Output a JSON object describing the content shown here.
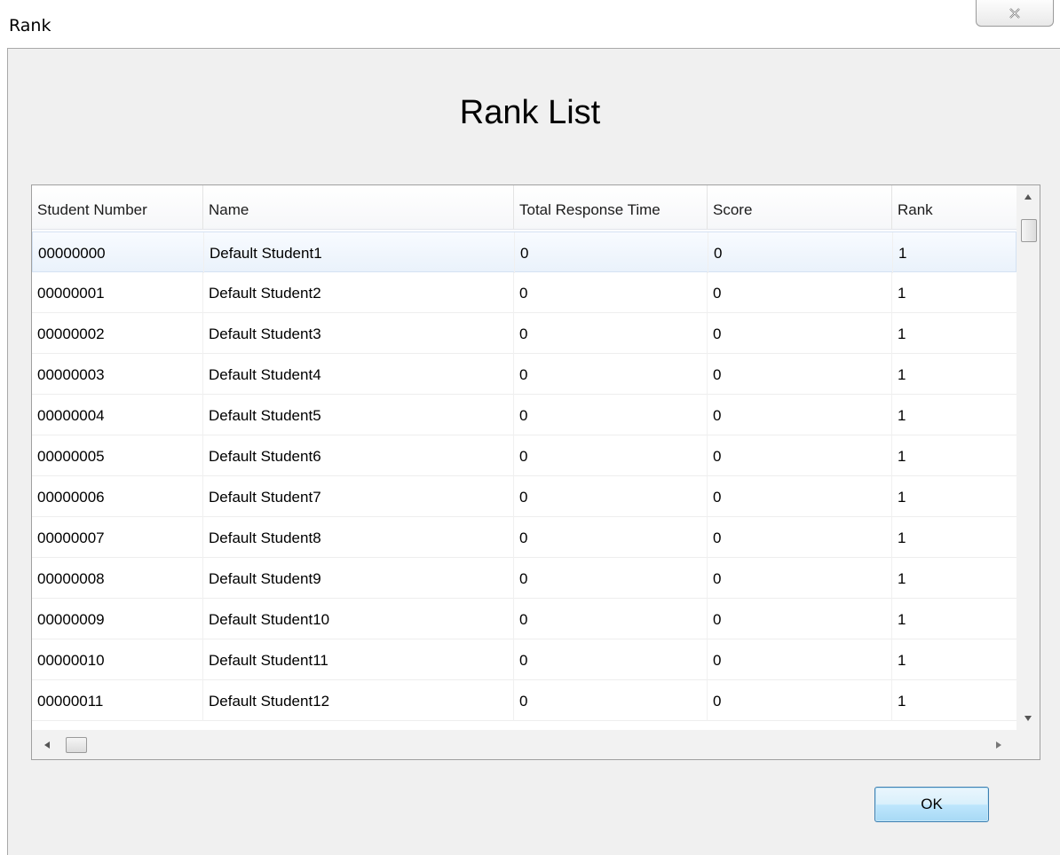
{
  "window": {
    "title": "Rank",
    "close_icon": "close-icon"
  },
  "page_title": "Rank List",
  "table": {
    "columns": [
      "Student Number",
      "Name",
      "Total Response Time",
      "Score",
      "Rank"
    ],
    "rows": [
      [
        "00000000",
        "Default Student1",
        "0",
        "0",
        "1"
      ],
      [
        "00000001",
        "Default Student2",
        "0",
        "0",
        "1"
      ],
      [
        "00000002",
        "Default Student3",
        "0",
        "0",
        "1"
      ],
      [
        "00000003",
        "Default Student4",
        "0",
        "0",
        "1"
      ],
      [
        "00000004",
        "Default Student5",
        "0",
        "0",
        "1"
      ],
      [
        "00000005",
        "Default Student6",
        "0",
        "0",
        "1"
      ],
      [
        "00000006",
        "Default Student7",
        "0",
        "0",
        "1"
      ],
      [
        "00000007",
        "Default Student8",
        "0",
        "0",
        "1"
      ],
      [
        "00000008",
        "Default Student9",
        "0",
        "0",
        "1"
      ],
      [
        "00000009",
        "Default Student10",
        "0",
        "0",
        "1"
      ],
      [
        "00000010",
        "Default Student11",
        "0",
        "0",
        "1"
      ],
      [
        "00000011",
        "Default Student12",
        "0",
        "0",
        "1"
      ]
    ],
    "selected_row": 0
  },
  "footer": {
    "ok_label": "OK"
  }
}
